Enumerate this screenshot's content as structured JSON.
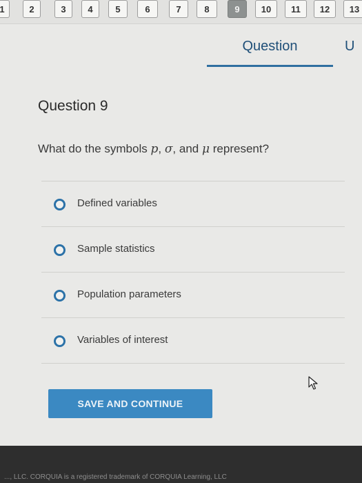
{
  "question_nav": {
    "numbers": [
      "1",
      "2",
      "3",
      "4",
      "5",
      "6",
      "7",
      "8",
      "9",
      "10",
      "11",
      "12",
      "13"
    ],
    "current": "9"
  },
  "tabs": {
    "active_label": "Question",
    "next_partial": "U"
  },
  "question": {
    "title": "Question 9",
    "prompt_before": "What do the symbols ",
    "sym_p": "p",
    "sep1": ", ",
    "sym_sigma": "σ",
    "sep2": ", and ",
    "sym_mu": "μ",
    "prompt_after": " represent?",
    "options": [
      "Defined variables",
      "Sample statistics",
      "Population parameters",
      "Variables of interest"
    ]
  },
  "actions": {
    "save_label": "SAVE AND CONTINUE"
  },
  "footer": {
    "text": "..., LLC. CORQUIA is a registered trademark of CORQUIA Learning, LLC"
  }
}
